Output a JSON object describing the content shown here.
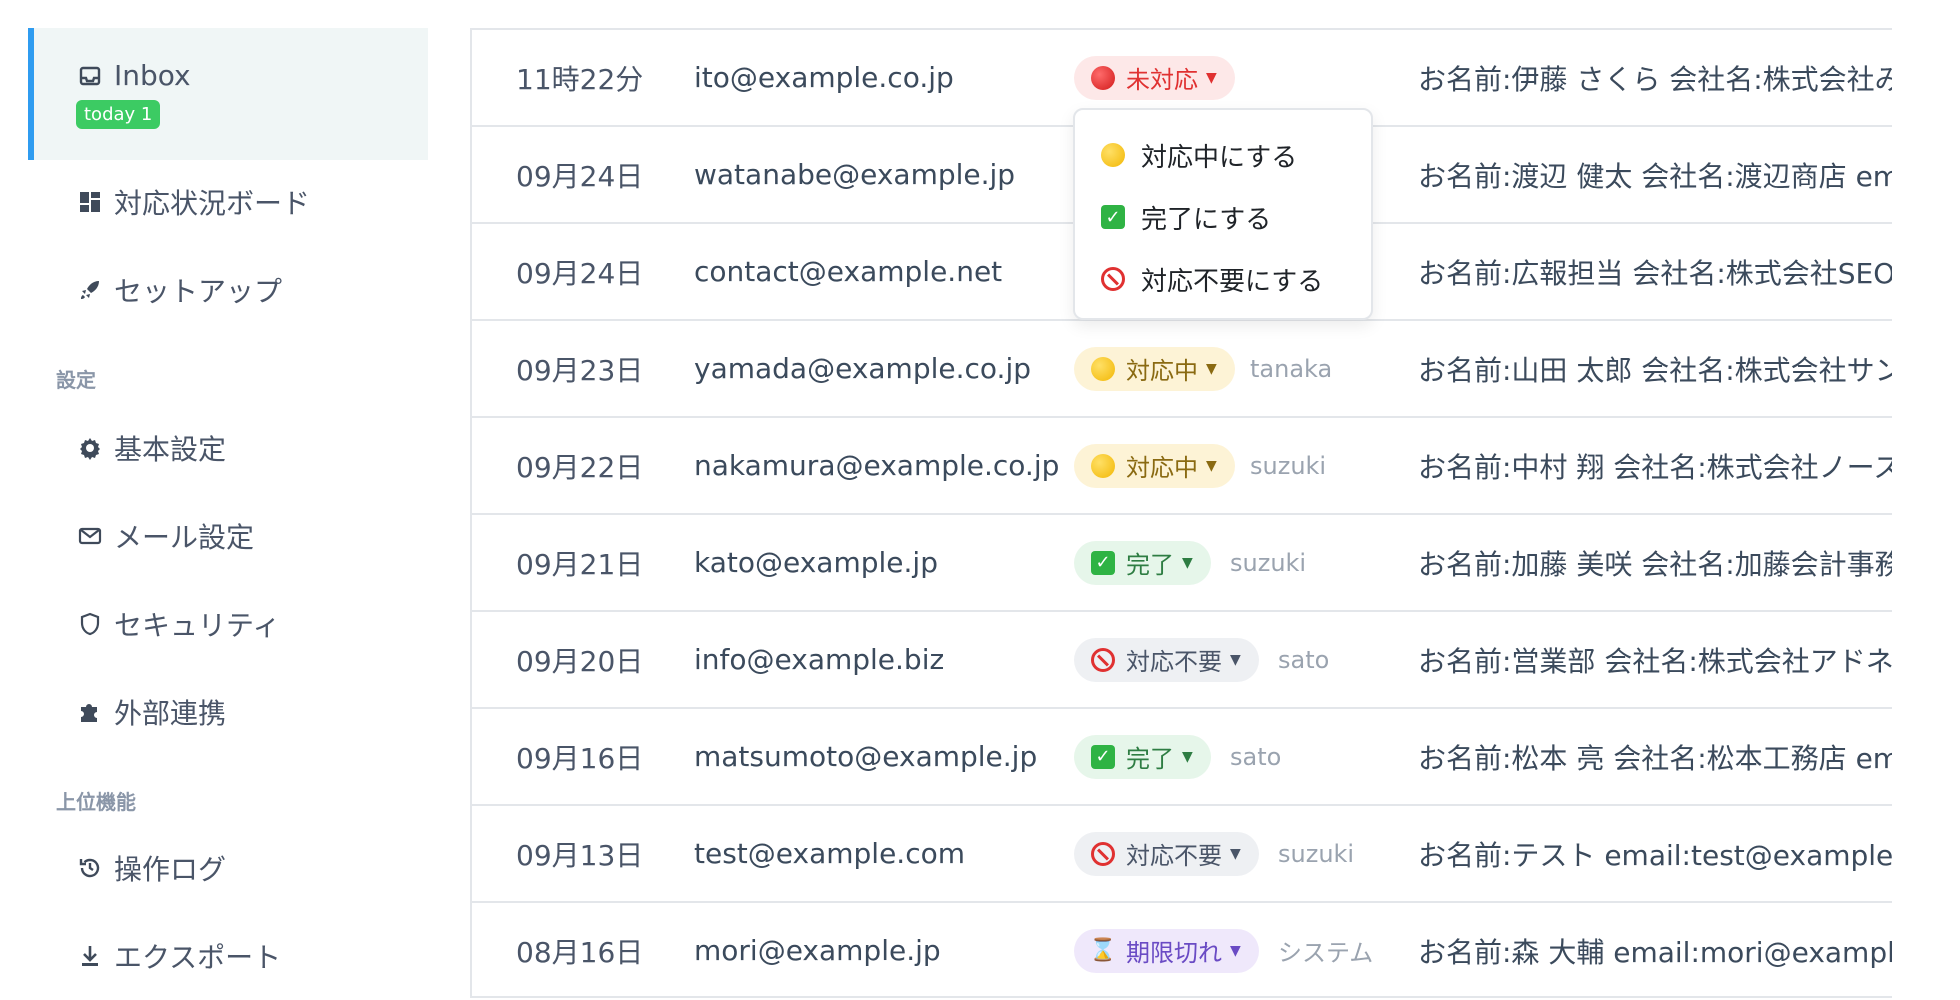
{
  "sidebar": {
    "inbox": {
      "label": "Inbox",
      "badge": "today 1"
    },
    "items_top": [
      {
        "label": "対応状況ボード",
        "icon": "dashboard-icon"
      },
      {
        "label": "セットアップ",
        "icon": "rocket-icon"
      }
    ],
    "section_settings": "設定",
    "items_settings": [
      {
        "label": "基本設定",
        "icon": "gear-icon"
      },
      {
        "label": "メール設定",
        "icon": "mail-icon"
      },
      {
        "label": "セキュリティ",
        "icon": "shield-icon"
      },
      {
        "label": "外部連携",
        "icon": "puzzle-icon"
      }
    ],
    "section_advanced": "上位機能",
    "items_advanced": [
      {
        "label": "操作ログ",
        "icon": "history-icon"
      },
      {
        "label": "エクスポート",
        "icon": "download-icon"
      }
    ]
  },
  "rows": [
    {
      "date": "11時22分",
      "email": "ito@example.co.jp",
      "status": "未対応",
      "status_kind": "red",
      "assignee": "",
      "detail": "お名前:伊藤 さくら 会社名:株式会社みらい"
    },
    {
      "date": "09月24日",
      "email": "watanabe@example.jp",
      "status": "",
      "status_kind": "",
      "assignee": "",
      "detail": "お名前:渡辺 健太 会社名:渡辺商店 email"
    },
    {
      "date": "09月24日",
      "email": "contact@example.net",
      "status": "",
      "status_kind": "",
      "assignee": "",
      "detail": "お名前:広報担当 会社名:株式会社SEOマ"
    },
    {
      "date": "09月23日",
      "email": "yamada@example.co.jp",
      "status": "対応中",
      "status_kind": "yellow",
      "assignee": "tanaka",
      "detail": "お名前:山田 太郎 会社名:株式会社サンプル"
    },
    {
      "date": "09月22日",
      "email": "nakamura@example.co.jp",
      "status": "対応中",
      "status_kind": "yellow",
      "assignee": "suzuki",
      "detail": "お名前:中村 翔 会社名:株式会社ノースタ"
    },
    {
      "date": "09月21日",
      "email": "kato@example.jp",
      "status": "完了",
      "status_kind": "green",
      "assignee": "suzuki",
      "detail": "お名前:加藤 美咲 会社名:加藤会計事務所"
    },
    {
      "date": "09月20日",
      "email": "info@example.biz",
      "status": "対応不要",
      "status_kind": "gray",
      "assignee": "sato",
      "detail": "お名前:営業部 会社名:株式会社アドネット"
    },
    {
      "date": "09月16日",
      "email": "matsumoto@example.jp",
      "status": "完了",
      "status_kind": "green",
      "assignee": "sato",
      "detail": "お名前:松本 亮 会社名:松本工務店 email"
    },
    {
      "date": "09月13日",
      "email": "test@example.com",
      "status": "対応不要",
      "status_kind": "gray",
      "assignee": "suzuki",
      "detail": "お名前:テスト email:test@example.com"
    },
    {
      "date": "08月16日",
      "email": "mori@example.jp",
      "status": "期限切れ",
      "status_kind": "purple",
      "assignee": "システム",
      "detail": "お名前:森 大輔 email:mori@example.jp"
    }
  ],
  "dropdown": {
    "items": [
      {
        "label": "対応中にする",
        "icon": "yellow-circle-icon"
      },
      {
        "label": "完了にする",
        "icon": "check-mark-icon"
      },
      {
        "label": "対応不要にする",
        "icon": "prohibited-icon"
      }
    ]
  },
  "colors": {
    "accent": "#2f9cf0",
    "today_badge": "#3ccb63",
    "status_red": "#e03131",
    "status_yellow": "#8a6a12",
    "status_green": "#2e7d43",
    "status_purple": "#6a4bc4"
  }
}
